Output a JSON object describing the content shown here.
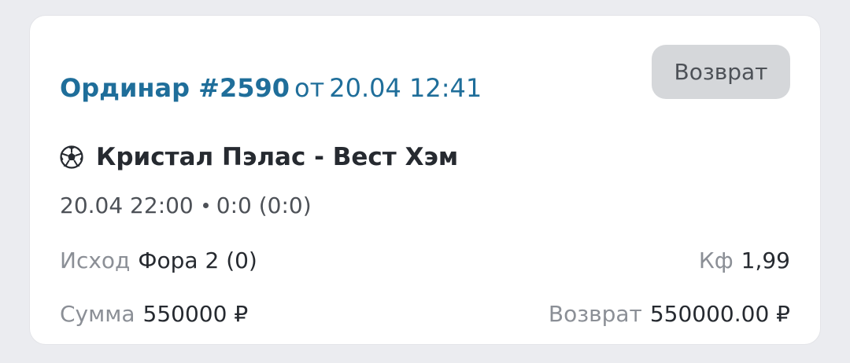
{
  "bet": {
    "title": "Ординар #2590",
    "from_label": "от",
    "date": "20.04 12:41",
    "status_button": "Возврат"
  },
  "match": {
    "sport_icon": "soccer-ball-icon",
    "title": "Кристал Пэлас - Вест Хэм",
    "datetime": "20.04 22:00",
    "score": "0:0 (0:0)"
  },
  "details": {
    "outcome_label": "Исход",
    "outcome_value": "Фора 2 (0)",
    "odds_label": "Кф",
    "odds_value": "1,99",
    "sum_label": "Сумма",
    "sum_value": "550000 ₽",
    "return_label": "Возврат",
    "return_value": "550000.00 ₽"
  },
  "colors": {
    "title_blue": "#1f6e9a",
    "background": "#ebecf0",
    "button_bg": "#d5d7da"
  }
}
